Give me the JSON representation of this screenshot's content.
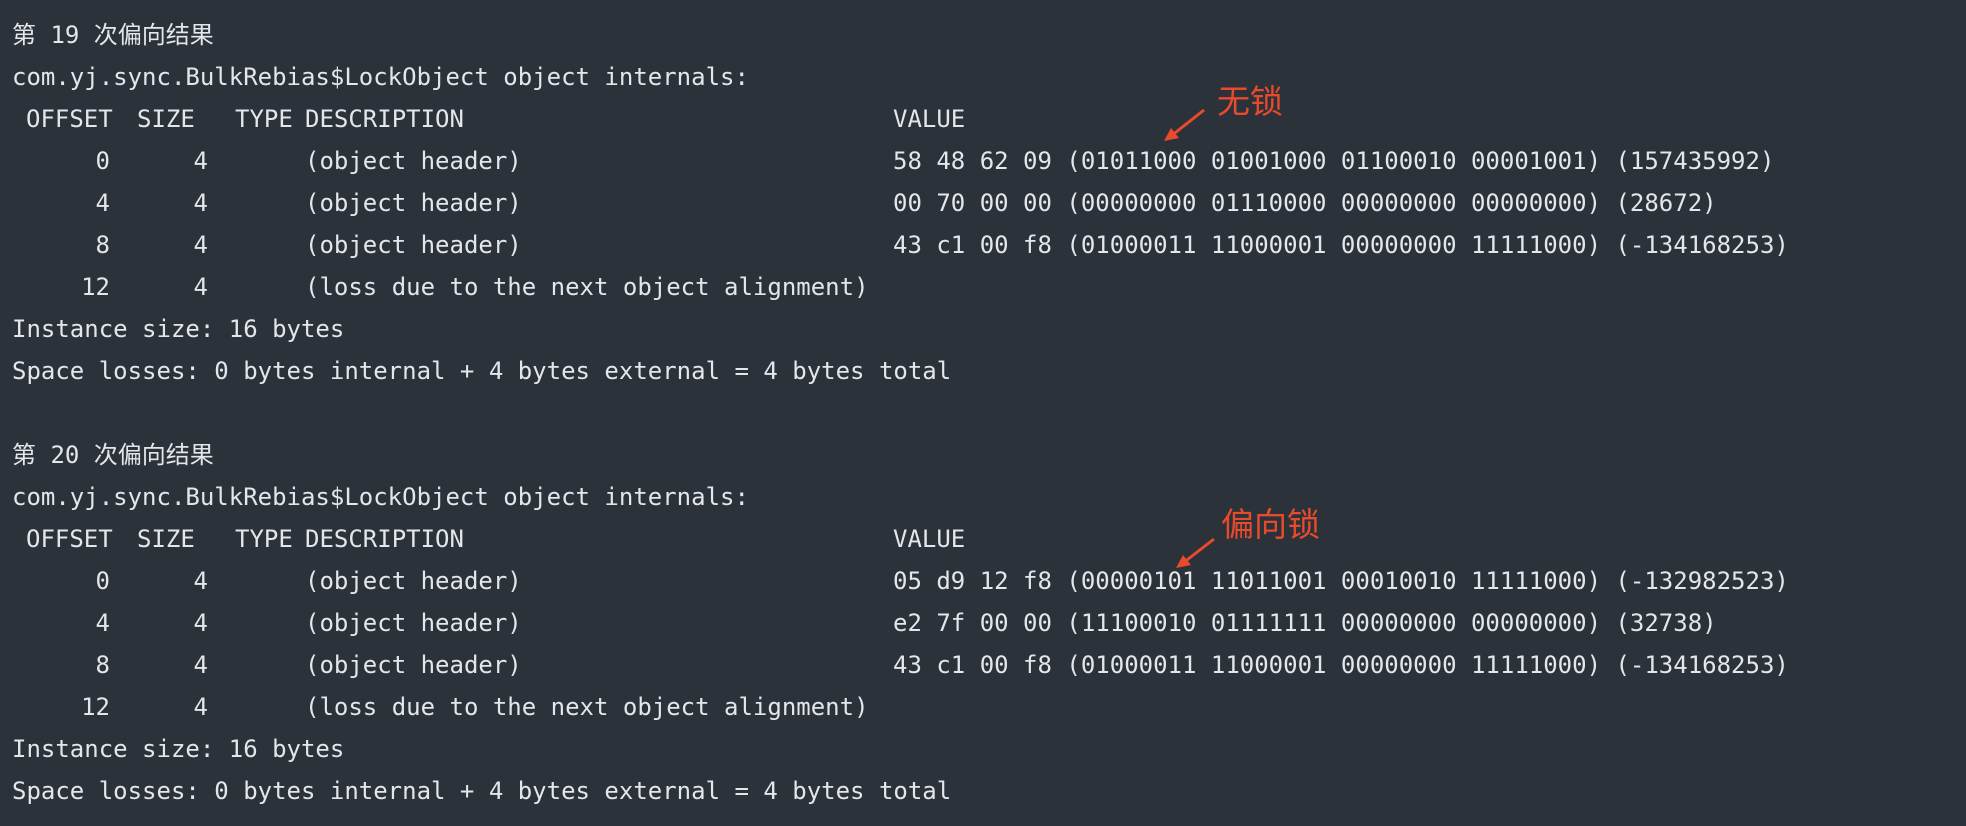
{
  "blocks": [
    {
      "heading": "第 19 次偏向结果",
      "class_line": "com.yj.sync.BulkRebias$LockObject object internals:",
      "header": {
        "offset": "OFFSET",
        "size": "SIZE",
        "type": "TYPE",
        "description": "DESCRIPTION",
        "value": "VALUE"
      },
      "rows": [
        {
          "offset": "0",
          "size": "4",
          "description": "(object header)",
          "value": "58 48 62 09 (01011000 01001000 01100010 00001001) (157435992)"
        },
        {
          "offset": "4",
          "size": "4",
          "description": "(object header)",
          "value": "00 70 00 00 (00000000 01110000 00000000 00000000) (28672)"
        },
        {
          "offset": "8",
          "size": "4",
          "description": "(object header)",
          "value": "43 c1 00 f8 (01000011 11000001 00000000 11111000) (-134168253)"
        },
        {
          "offset": "12",
          "size": "4",
          "description": "(loss due to the next object alignment)",
          "value": ""
        }
      ],
      "instance_size": "Instance size: 16 bytes",
      "space_losses": "Space losses: 0 bytes internal + 4 bytes external = 4 bytes total",
      "annotation": "无锁"
    },
    {
      "heading": "第 20 次偏向结果",
      "class_line": "com.yj.sync.BulkRebias$LockObject object internals:",
      "header": {
        "offset": "OFFSET",
        "size": "SIZE",
        "type": "TYPE",
        "description": "DESCRIPTION",
        "value": "VALUE"
      },
      "rows": [
        {
          "offset": "0",
          "size": "4",
          "description": "(object header)",
          "value": "05 d9 12 f8 (00000101 11011001 00010010 11111000) (-132982523)"
        },
        {
          "offset": "4",
          "size": "4",
          "description": "(object header)",
          "value": "e2 7f 00 00 (11100010 01111111 00000000 00000000) (32738)"
        },
        {
          "offset": "8",
          "size": "4",
          "description": "(object header)",
          "value": "43 c1 00 f8 (01000011 11000001 00000000 11111000) (-134168253)"
        },
        {
          "offset": "12",
          "size": "4",
          "description": "(loss due to the next object alignment)",
          "value": ""
        }
      ],
      "instance_size": "Instance size: 16 bytes",
      "space_losses": "Space losses: 0 bytes internal + 4 bytes external = 4 bytes total",
      "annotation": "偏向锁"
    }
  ],
  "colors": {
    "background": "#2b323a",
    "text": "#e3e6ea",
    "annotation": "#e84a2c"
  }
}
